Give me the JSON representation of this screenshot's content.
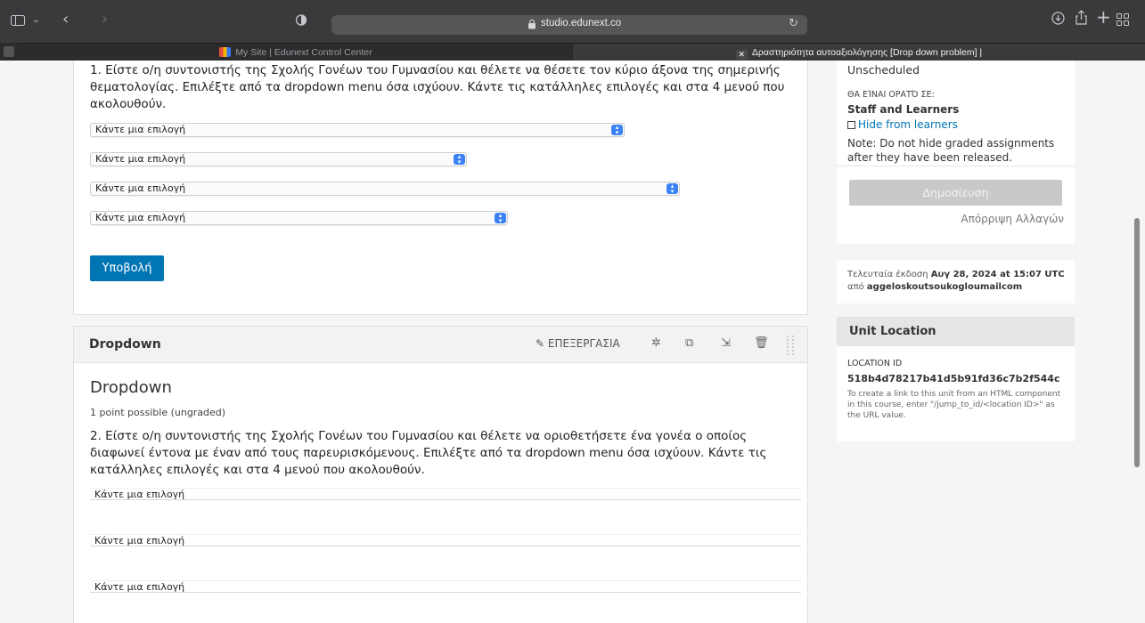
{
  "browser": {
    "url": "studio.edunext.co",
    "tabs": [
      {
        "label": "My Site | Edunext Control Center"
      },
      {
        "label": "Δραστηριότητα αυτοαξιολόγησης [Drop down problem] |"
      }
    ]
  },
  "problem1": {
    "question": "1. Είστε ο/η συντονιστής της Σχολής Γονέων του Γυμνασίου και θέλετε να θέσετε τον κύριο άξονα της σημερινής θεματολογίας. Επιλέξτε από τα dropdown menu όσα ισχύουν. Κάντε τις κατάλληλες επιλογές και στα 4 μενού που ακολουθούν.",
    "dropdowns": [
      "Κάντε μια επιλογή",
      "Κάντε μια επιλογή",
      "Κάντε μια επιλογή",
      "Κάντε μια επιλογή"
    ],
    "submit_label": "Υποβολή"
  },
  "component": {
    "header_title": "Dropdown",
    "edit_label": "ΕΠΕΞΕΡΓΑΣΙΑ",
    "icons": [
      "pencil-icon",
      "gear-icon",
      "duplicate-icon",
      "move-icon",
      "trash-icon",
      "drag-handle-icon"
    ]
  },
  "problem2": {
    "title": "Dropdown",
    "points": "1 point possible (ungraded)",
    "question": "2. Είστε ο/η συντονιστής της Σχολής Γονέων του Γυμνασίου και θέλετε να οριοθετήσετε ένα γονέα ο οποίος διαφωνεί έντονα με έναν από τους παρευρισκόμενους. Επιλέξτε από τα dropdown menu όσα ισχύουν. Κάντε τις κατάλληλες επιλογές και στα 4 μενού που ακολουθούν.",
    "dropdowns": [
      "Κάντε μια επιλογή",
      "Κάντε μια επιλογή",
      "Κάντε μια επιλογή"
    ]
  },
  "sidebar": {
    "schedule_status": "Unscheduled",
    "visible_to_label": "ΘΑ ΕΊΝΑΙ ΟΡΑΤΌ ΣΕ:",
    "visible_to_value": "Staff and Learners",
    "hide_label": "Hide from learners",
    "note": "Note: Do not hide graded assignments after they have been released.",
    "publish_label": "Δημοσίευση",
    "discard_label": "Απόρριψη Αλλαγών",
    "last_published_prefix": "Τελευταία έκδοση",
    "last_published_date": "Αυγ 28, 2024 at 15:07 UTC",
    "last_published_by_prefix": "από",
    "last_published_by": "aggeloskoutsoukogloumailcom",
    "unit_location_heading": "Unit Location",
    "location_id_label": "LOCATION ID",
    "location_id": "518b4d78217b41d5b91fd36c7b2f544c",
    "location_help": "To create a link to this unit from an HTML component in this course, enter \"/jump_to_id/<location ID>\" as the URL value."
  },
  "colors": {
    "primary_button": "#0075b4",
    "link": "#0075b4",
    "disabled_button": "#c9c9c9"
  }
}
